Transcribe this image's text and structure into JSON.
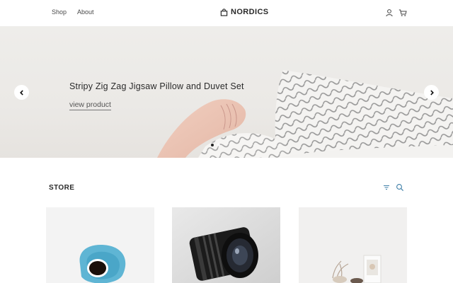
{
  "header": {
    "nav": [
      {
        "label": "Shop"
      },
      {
        "label": "About"
      }
    ],
    "brand": {
      "name": "NORDICS",
      "icon": "shopping-bag-icon"
    },
    "icons": [
      "user-icon",
      "cart-icon"
    ]
  },
  "hero": {
    "title": "Stripy Zig Zag Jigsaw Pillow and Duvet Set",
    "link_label": "view product",
    "prev_icon": "chevron-left-icon",
    "next_icon": "chevron-right-icon",
    "slides": 2,
    "active_slide": 1
  },
  "store": {
    "title": "STORE",
    "icons": [
      "filter-icon",
      "search-icon"
    ]
  },
  "products": [
    {
      "image": "blue-coffee-cup"
    },
    {
      "image": "camera-lens"
    },
    {
      "image": "decor-vase"
    }
  ],
  "colors": {
    "text": "#2b2b2b",
    "hero_bg": "#ebe9e6",
    "accent": "#2a2a2a"
  }
}
